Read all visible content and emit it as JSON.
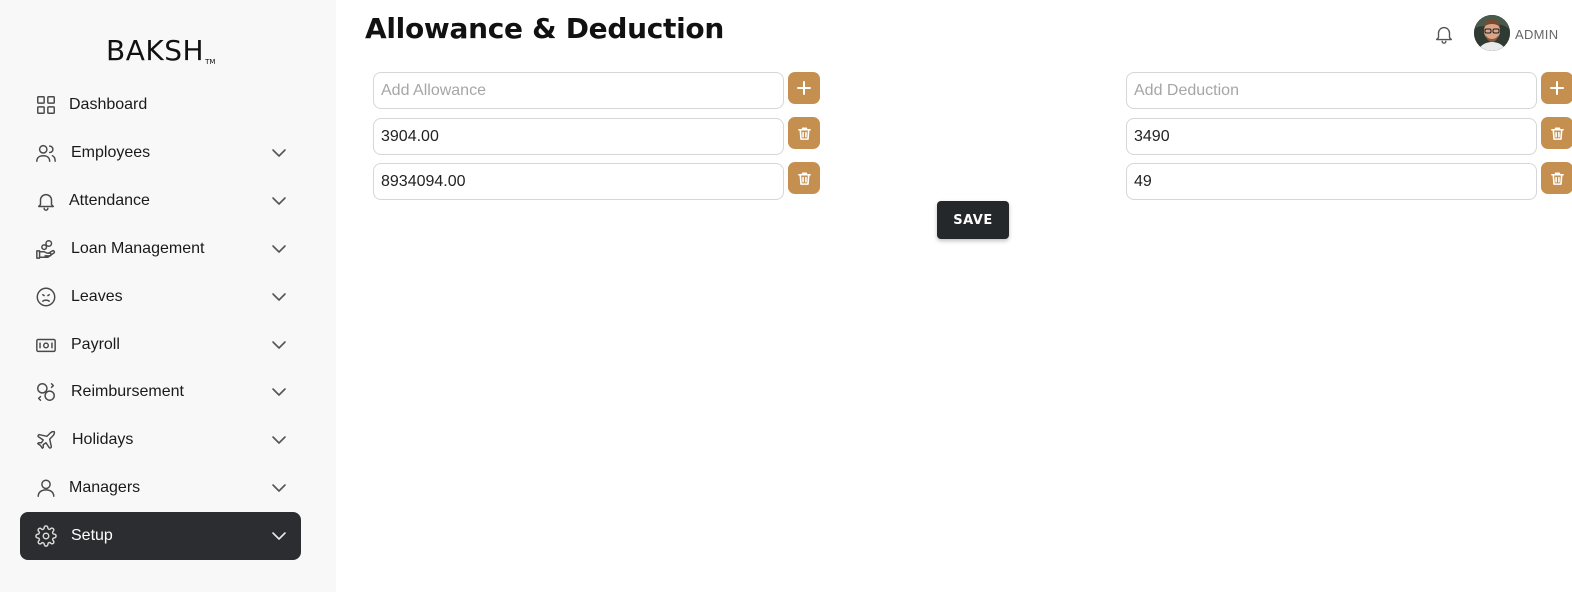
{
  "brand": {
    "name": "BAKSH",
    "tm": "TM"
  },
  "sidebar": {
    "items": [
      {
        "label": "Dashboard",
        "icon": "grid-icon",
        "has_chevron": false
      },
      {
        "label": "Employees",
        "icon": "users-icon",
        "has_chevron": true
      },
      {
        "label": "Attendance",
        "icon": "bell-icon",
        "has_chevron": true
      },
      {
        "label": "Loan Management",
        "icon": "hand-coins-icon",
        "has_chevron": true
      },
      {
        "label": "Leaves",
        "icon": "sad-face-icon",
        "has_chevron": true
      },
      {
        "label": "Payroll",
        "icon": "banknote-icon",
        "has_chevron": true
      },
      {
        "label": "Reimbursement",
        "icon": "exchange-icon",
        "has_chevron": true
      },
      {
        "label": "Holidays",
        "icon": "plane-icon",
        "has_chevron": true
      },
      {
        "label": "Managers",
        "icon": "user-icon",
        "has_chevron": true
      },
      {
        "label": "Setup",
        "icon": "gear-icon",
        "has_chevron": true,
        "active": true
      }
    ]
  },
  "header": {
    "title": "Allowance & Deduction",
    "user_label": "ADMIN"
  },
  "allowance": {
    "placeholder": "Add Allowance",
    "items": [
      "3904.00",
      "8934094.00"
    ]
  },
  "deduction": {
    "placeholder": "Add Deduction",
    "items": [
      "3490",
      "49"
    ]
  },
  "save_label": "SAVE",
  "colors": {
    "accent": "#c48f4f",
    "active_nav": "#2b2d30",
    "save_button": "#25282b",
    "sidebar_bg": "#f8f8f8"
  }
}
